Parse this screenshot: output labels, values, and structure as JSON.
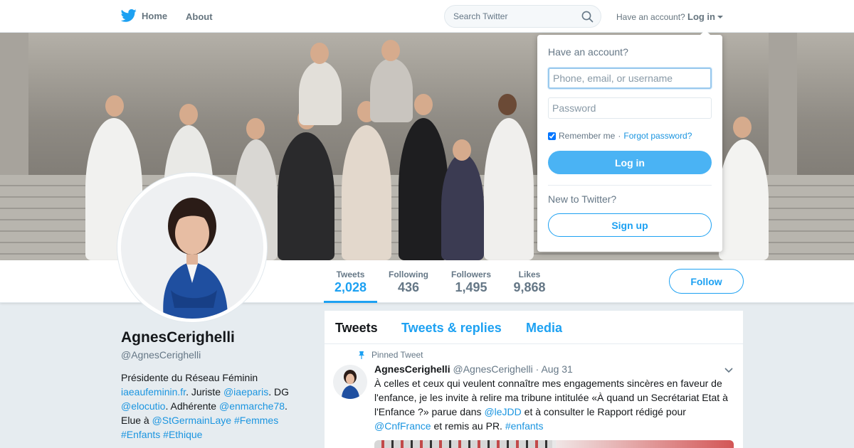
{
  "nav": {
    "home_label": "Home",
    "about_label": "About",
    "search_placeholder": "Search Twitter",
    "have_account": "Have an account?",
    "login_label": "Log in"
  },
  "stats": [
    {
      "label": "Tweets",
      "value": "2,028"
    },
    {
      "label": "Following",
      "value": "436"
    },
    {
      "label": "Followers",
      "value": "1,495"
    },
    {
      "label": "Likes",
      "value": "9,868"
    }
  ],
  "follow_label": "Follow",
  "profile": {
    "name": "AgnesCerighelli",
    "handle": "@AgnesCerighelli",
    "bio": {
      "t1": "Présidente du Réseau Féminin ",
      "l1": "iaeaufeminin.fr",
      "t2": ". Juriste ",
      "l2": "@iaeparis",
      "t3": ". DG ",
      "l3": "@elocutio",
      "t4": ". Adhérente ",
      "l4": "@enmarche78",
      "t5": ". Elue à ",
      "l5": "@StGermainLaye",
      "l6": "#Femmes",
      "l7": "#Enfants",
      "l8": "#Ethique"
    }
  },
  "timeline": {
    "tabs": [
      "Tweets",
      "Tweets & replies",
      "Media"
    ],
    "pinned_label": "Pinned Tweet",
    "tweet": {
      "name": "AgnesCerighelli",
      "handle": "@AgnesCerighelli",
      "sep": "·",
      "date": "Aug 31",
      "t1": "À celles et ceux qui veulent connaître mes engagements sincères en faveur de l'enfance, je les invite à relire ma tribune intitulée «À quand un Secrétariat Etat à l'Enfance ?» parue dans ",
      "l1": "@leJDD",
      "t2": " et à consulter le Rapport rédigé pour ",
      "l2": "@CnfFrance",
      "t3": " et remis au PR. ",
      "l3": "#enfants"
    }
  },
  "login_dropdown": {
    "title": "Have an account?",
    "username_placeholder": "Phone, email, or username",
    "password_placeholder": "Password",
    "remember_label": "Remember me",
    "remember_checked": true,
    "sep": "·",
    "forgot_label": "Forgot password?",
    "login_button": "Log in",
    "new_label": "New to Twitter?",
    "signup_button": "Sign up"
  },
  "colors": {
    "brand": "#1da1f2",
    "link": "#1b95e0",
    "login_button": "#4ab3f4",
    "background": "#e6ecf0"
  },
  "icons": [
    "twitter-bird-icon",
    "search-icon",
    "caret-down-icon",
    "pin-icon",
    "chevron-down-icon"
  ]
}
